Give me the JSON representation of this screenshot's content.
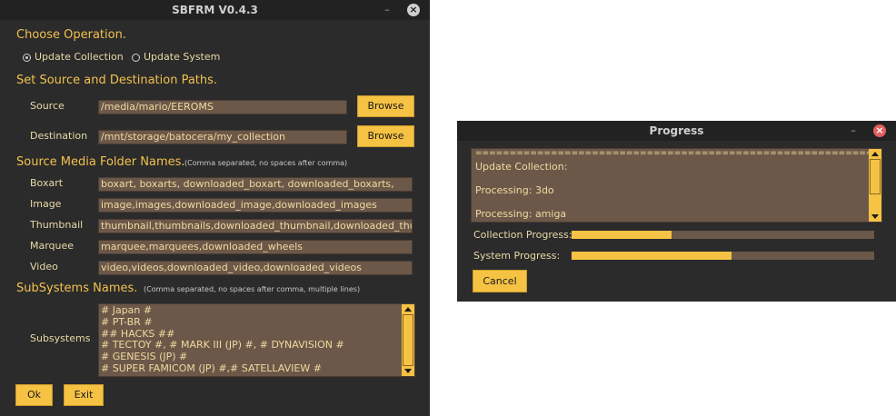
{
  "main_window": {
    "title": "SBFRM V0.4.3",
    "minimize_glyph": "–",
    "close_glyph": "×",
    "choose_operation_heading": "Choose Operation.",
    "operation_options": [
      {
        "label": "Update Collection",
        "selected": true
      },
      {
        "label": "Update System",
        "selected": false
      }
    ],
    "paths_heading": "Set Source and Destination Paths.",
    "source": {
      "label": "Source",
      "value": "/media/mario/EEROMS",
      "browse_label": "Browse"
    },
    "destination": {
      "label": "Destination",
      "value": "/mnt/storage/batocera/my_collection",
      "browse_label": "Browse"
    },
    "media_heading": "Source Media Folder Names.",
    "media_note": "(Comma separated, no spaces after comma)",
    "media_fields": [
      {
        "label": "Boxart",
        "value": "boxart, boxarts, downloaded_boxart,  downloaded_boxarts,"
      },
      {
        "label": "Image",
        "value": "image,images,downloaded_image,downloaded_images"
      },
      {
        "label": "Thumbnail",
        "value": "thumbnail,thumbnails,downloaded_thumbnail,downloaded_thumbnails"
      },
      {
        "label": "Marquee",
        "value": "marquee,marquees,downloaded_wheels"
      },
      {
        "label": "Video",
        "value": "video,videos,downloaded_video,downloaded_videos"
      }
    ],
    "subsystems_heading": "SubSystems Names.",
    "subsystems_note": "(Comma separated, no spaces after comma, multiple lines)",
    "subsystems_label": "Subsystems",
    "subsystems_lines": [
      "# Japan #",
      "# PT-BR #",
      "## HACKS ##",
      "# TECTOY #, # MARK III (JP) #, # DYNAVISION #",
      "# GENESIS (JP) #",
      "# SUPER FAMICOM (JP) #,# SATELLAVIEW #"
    ],
    "ok_label": "Ok",
    "exit_label": "Exit"
  },
  "progress_window": {
    "title": "Progress",
    "minimize_glyph": "–",
    "close_glyph": "×",
    "log_lines": [
      "==========================================================",
      "Update Collection:",
      "",
      " Processing: 3do",
      "",
      " Processing: amiga"
    ],
    "collection_progress_label": "Collection Progress:",
    "collection_progress": 0.33,
    "system_progress_label": "System Progress:",
    "system_progress": 0.53,
    "cancel_label": "Cancel"
  },
  "colors": {
    "accent": "#f6c243",
    "heading": "#f2c14e",
    "field_bg": "#6b5849",
    "window_bg": "#2b2b2b",
    "titlebar_bg": "#222222"
  }
}
